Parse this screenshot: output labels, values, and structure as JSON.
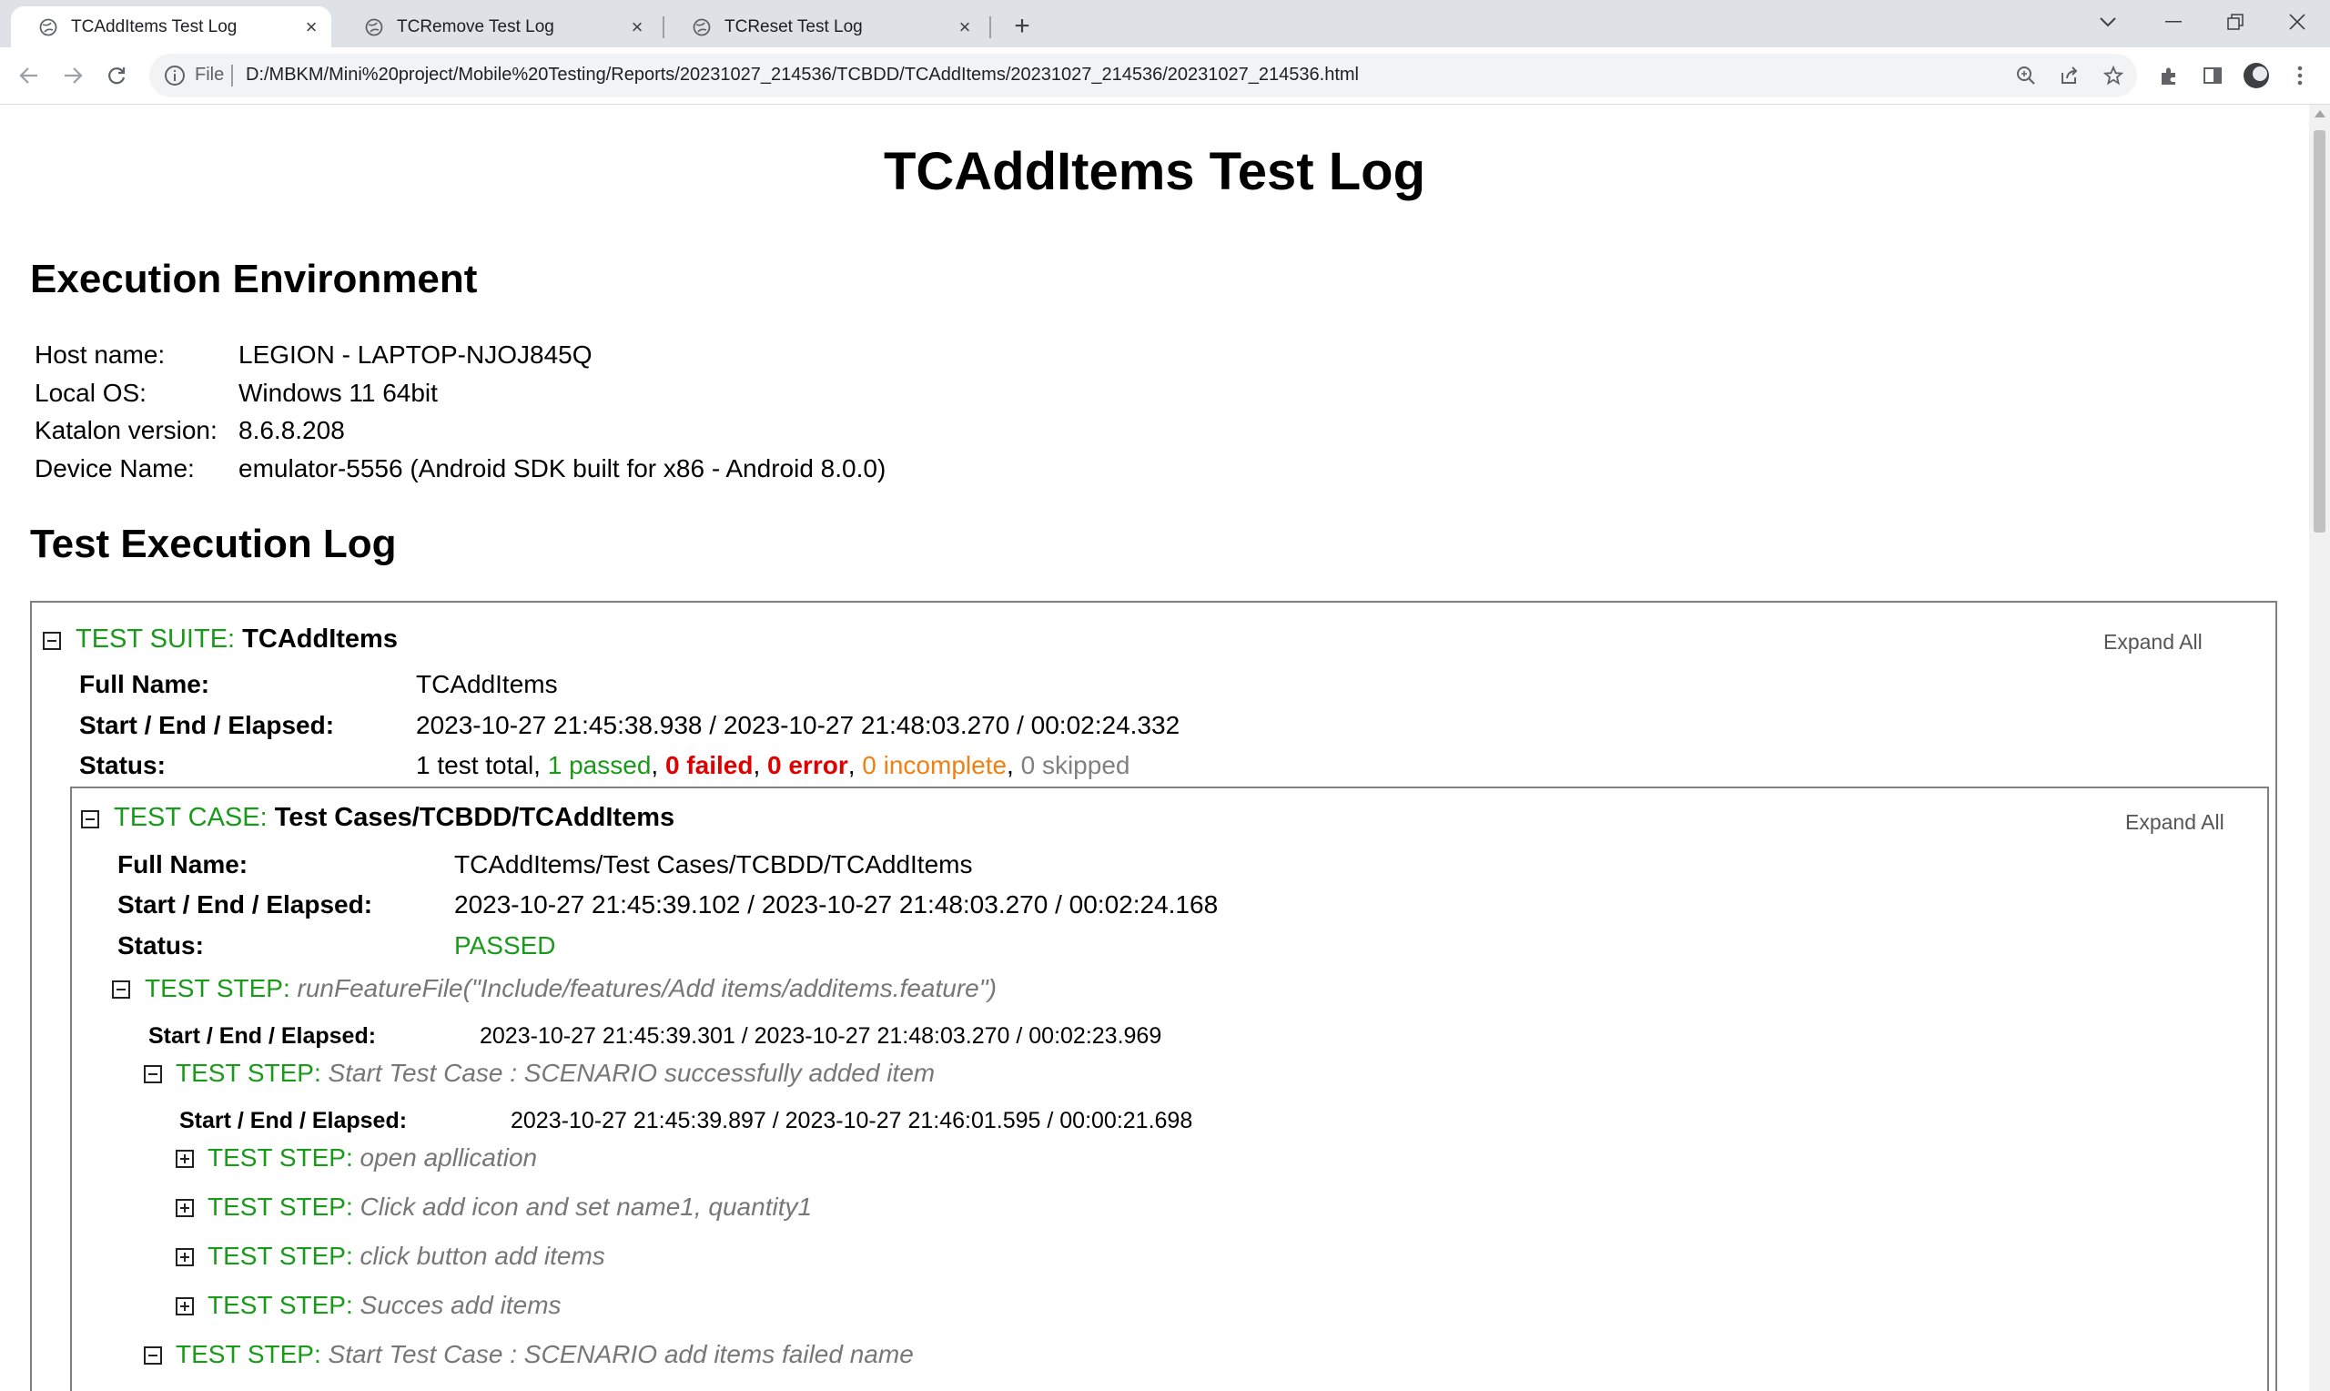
{
  "browser": {
    "tabs": [
      {
        "title": "TCAddItems Test Log",
        "active": true
      },
      {
        "title": "TCRemove Test Log",
        "active": false
      },
      {
        "title": "TCReset Test Log",
        "active": false
      }
    ],
    "address": {
      "scheme_label": "File",
      "url": "D:/MBKM/Mini%20project/Mobile%20Testing/Reports/20231027_214536/TCBDD/TCAddItems/20231027_214536/20231027_214536.html"
    }
  },
  "report": {
    "title": "TCAddItems Test Log",
    "env_heading": "Execution Environment",
    "env": [
      {
        "key": "Host name:",
        "value": "LEGION - LAPTOP-NJOJ845Q"
      },
      {
        "key": "Local OS:",
        "value": "Windows 11 64bit"
      },
      {
        "key": "Katalon version:",
        "value": "8.6.8.208"
      },
      {
        "key": "Device Name:",
        "value": "emulator-5556 (Android SDK built for x86 - Android 8.0.0)"
      }
    ],
    "log_heading": "Test Execution Log",
    "expand_all": "Expand All",
    "suite": {
      "prefix": "TEST SUITE:",
      "name": "TCAddItems",
      "full_name_label": "Full Name:",
      "full_name": "TCAddItems",
      "time_label": "Start / End / Elapsed:",
      "time": "2023-10-27 21:45:38.938 / 2023-10-27 21:48:03.270 / 00:02:24.332",
      "status_label": "Status:",
      "status": {
        "total": "1 test total,",
        "passed": "1 passed",
        "failed": "0 failed",
        "error": "0 error",
        "incomplete": "0 incomplete",
        "skipped": "0 skipped",
        "comma": ","
      }
    },
    "case": {
      "prefix": "TEST CASE:",
      "name": "Test Cases/TCBDD/TCAddItems",
      "full_name_label": "Full Name:",
      "full_name": "TCAddItems/Test Cases/TCBDD/TCAddItems",
      "time_label": "Start / End / Elapsed:",
      "time": "2023-10-27 21:45:39.102 / 2023-10-27 21:48:03.270 / 00:02:24.168",
      "status_label": "Status:",
      "status": "PASSED"
    },
    "steps": {
      "prefix": "TEST STEP:",
      "feature": {
        "name": "runFeatureFile(\"Include/features/Add items/additems.feature\")",
        "time_label": "Start / End / Elapsed:",
        "time": "2023-10-27 21:45:39.301 / 2023-10-27 21:48:03.270 / 00:02:23.969"
      },
      "scenario1": {
        "name": "Start Test Case : SCENARIO successfully added item",
        "time_label": "Start / End / Elapsed:",
        "time": "2023-10-27 21:45:39.897 / 2023-10-27 21:46:01.595 / 00:00:21.698"
      },
      "sub": [
        {
          "name": "open apllication"
        },
        {
          "name": "Click add icon and set name1, quantity1"
        },
        {
          "name": "click button add items"
        },
        {
          "name": "Succes add items"
        }
      ],
      "scenario2": {
        "name": "Start Test Case : SCENARIO add items failed name"
      }
    }
  },
  "colors": {
    "pass_green": "#1a9a1a",
    "fail_red": "#e00000",
    "incomplete_orange": "#f08010",
    "muted_grey": "#808080"
  }
}
